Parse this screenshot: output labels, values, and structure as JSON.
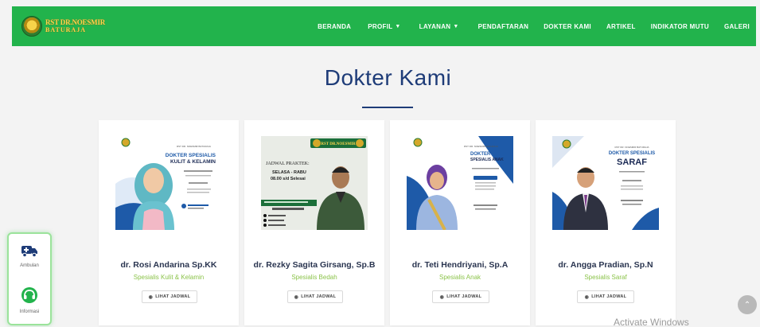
{
  "navbar": {
    "logo_line1": "RST DR.NOESMIR",
    "logo_line2": "BATURAJA",
    "items": [
      {
        "label": "BERANDA",
        "caret": ""
      },
      {
        "label": "PROFIL",
        "caret": "▼"
      },
      {
        "label": "LAYANAN",
        "caret": "▼"
      },
      {
        "label": "PENDAFTARAN",
        "caret": ""
      },
      {
        "label": "DOKTER KAMI",
        "caret": ""
      },
      {
        "label": "ARTIKEL",
        "caret": ""
      },
      {
        "label": "INDIKATOR MUTU",
        "caret": ""
      },
      {
        "label": "GALERI",
        "caret": ""
      }
    ]
  },
  "section": {
    "title": "Dokter Kami"
  },
  "doctors": [
    {
      "name": "dr. Rosi Andarina Sp.KK",
      "specialty": "Spesialis Kulit & Kelamin",
      "button": "LIHAT JADWAL",
      "poster": {
        "heading1": "DOKTER SPESIALIS",
        "heading2": "KULIT & KELAMIN",
        "accent": "#1e5aa8"
      }
    },
    {
      "name": "dr. Rezky Sagita Girsang, Sp.B",
      "specialty": "Spesialis Bedah",
      "button": "LIHAT JADWAL",
      "poster": {
        "heading1": "JADWAL PRAKTEK:",
        "heading2": "SELASA - RABU",
        "heading3": "08.00 s/d Selesai",
        "accent": "#1b6f3a"
      }
    },
    {
      "name": "dr. Teti Hendriyani, Sp.A",
      "specialty": "Spesialis Anak",
      "button": "LIHAT JADWAL",
      "poster": {
        "heading1": "DOKTER",
        "heading2": "SPESIALIS ANAK",
        "accent": "#1e5aa8"
      }
    },
    {
      "name": "dr. Angga Pradian, Sp.N",
      "specialty": "Spesialis Saraf",
      "button": "LIHAT JADWAL",
      "poster": {
        "heading1": "DOKTER SPESIALIS",
        "heading2": "SARAF",
        "accent": "#1e5aa8"
      }
    }
  ],
  "widget": {
    "ambulance_label": "Ambulan",
    "info_label": "Informasi"
  },
  "watermark": "Activate Windows",
  "colors": {
    "navbar": "#22b34c",
    "title": "#1e3c78",
    "specialty": "#8bc34a"
  }
}
